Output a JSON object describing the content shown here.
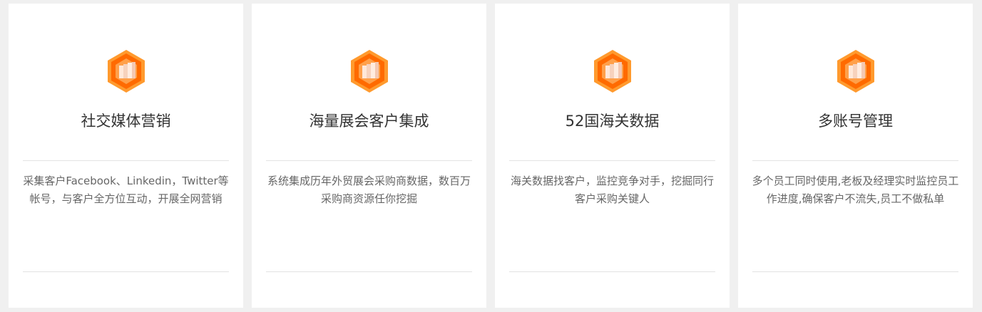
{
  "cards": [
    {
      "icon": "orange-hexagon-cube-icon",
      "title": "社交媒体营销",
      "description": "采集客户Facebook、Linkedin，Twitter等帐号，与客户全方位互动，开展全网营销"
    },
    {
      "icon": "orange-hexagon-cube-icon",
      "title": "海量展会客户集成",
      "description": "系统集成历年外贸展会采购商数据，数百万采购商资源任你挖掘"
    },
    {
      "icon": "orange-hexagon-cube-icon",
      "title": "52国海关数据",
      "description": "海关数据找客户，监控竞争对手，挖掘同行客户采购关键人"
    },
    {
      "icon": "orange-hexagon-cube-icon",
      "title": "多账号管理",
      "description": "多个员工同时使用,老板及经理实时监控员工作进度,确保客户不流失,员工不做私单"
    }
  ],
  "colors": {
    "page_background": "#f0f0f0",
    "card_background": "#ffffff",
    "icon_orange": "#ff6a00",
    "icon_light_orange": "#ff9a2e",
    "title_text": "#333333",
    "description_text": "#666666",
    "divider": "#e3e3e3"
  }
}
